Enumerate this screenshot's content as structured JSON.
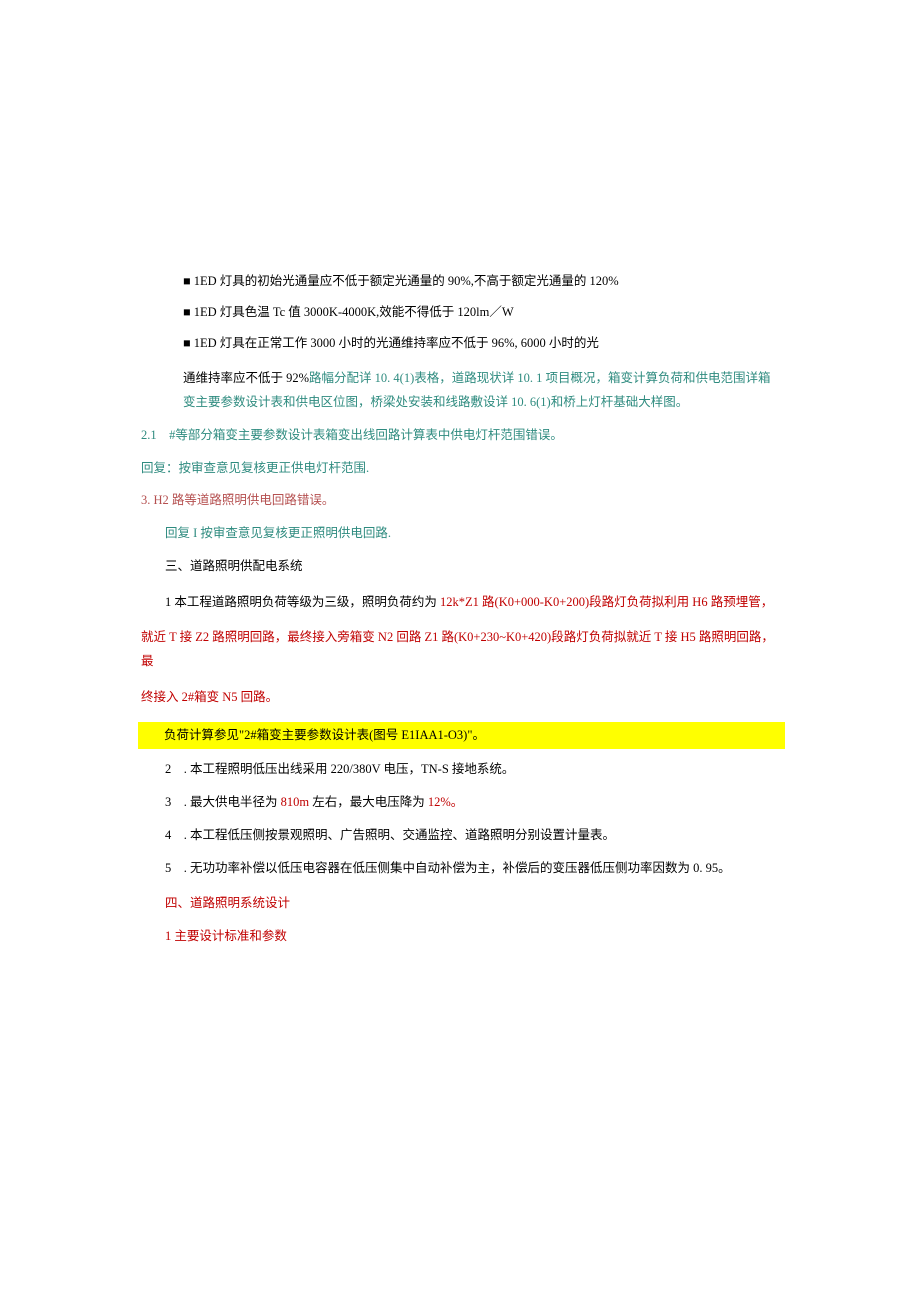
{
  "b1": "1ED 灯具的初始光通量应不低于额定光通量的 90%,不高于额定光通量的 120%",
  "b2": "1ED 灯具色温 Tc 值 3000K-4000K,效能不得低于 120lm／W",
  "b3": "1ED 灯具在正常工作 3000 小时的光通维持率应不低于 96%, 6000 小时的光",
  "p1_a": "通维持率应不低于 92%",
  "p1_b": "路幅分配详 10. 4(1)表格，道路现状详 10. 1 项目概况，箱变计算负荷和供电范围详箱变主要参数设计表和供电区位图，桥梁处安装和线路敷设详 10. 6(1)和桥上灯杆基础大样图。",
  "s21": "2.1　#等部分箱变主要参数设计表箱变出线回路计算表中供电灯杆范围错误。",
  "r1": "回复：按审查意见复核更正供电灯杆范围.",
  "s3": "3. H2 路等道路照明供电回路错误。",
  "r2": "回复 I 按审查意见复核更正照明供电回路.",
  "h3": "三、道路照明供配电系统",
  "p2_a": "1 本工程道路照明负荷等级为三级，照明负荷约为 ",
  "p2_b": "12k*Z1 路(K0+000-K0+200)段路灯负荷拟利用 H6 路预埋管，",
  "p3": "就近 T 接 Z2 路照明回路，最终接入旁箱变 N2 回路  Z1 路(K0+230~K0+420)段路灯负荷拟就近 T 接 H5 路照明回路，最",
  "p4": "终接入 2#箱变 N5 回路。",
  "hl": "负荷计算参见\"2#箱变主要参数设计表(图号 E1IAA1-O3)\"。",
  "n2": "2　. 本工程照明低压出线采用 220/380V 电压，TN-S 接地系统。",
  "n3_a": "3　. 最大供电半径为 ",
  "n3_b": "810m ",
  "n3_c": "左右，最大电压降为 ",
  "n3_d": "12%。",
  "n4": "4　. 本工程低压侧按景观照明、广告照明、交通监控、道路照明分别设置计量表。",
  "n5": "5　. 无功功率补偿以低压电容器在低压侧集中自动补偿为主，补偿后的变压器低压侧功率因数为 0. 95。",
  "h4": "四、道路照明系统设计",
  "h4s": "1 主要设计标准和参数"
}
